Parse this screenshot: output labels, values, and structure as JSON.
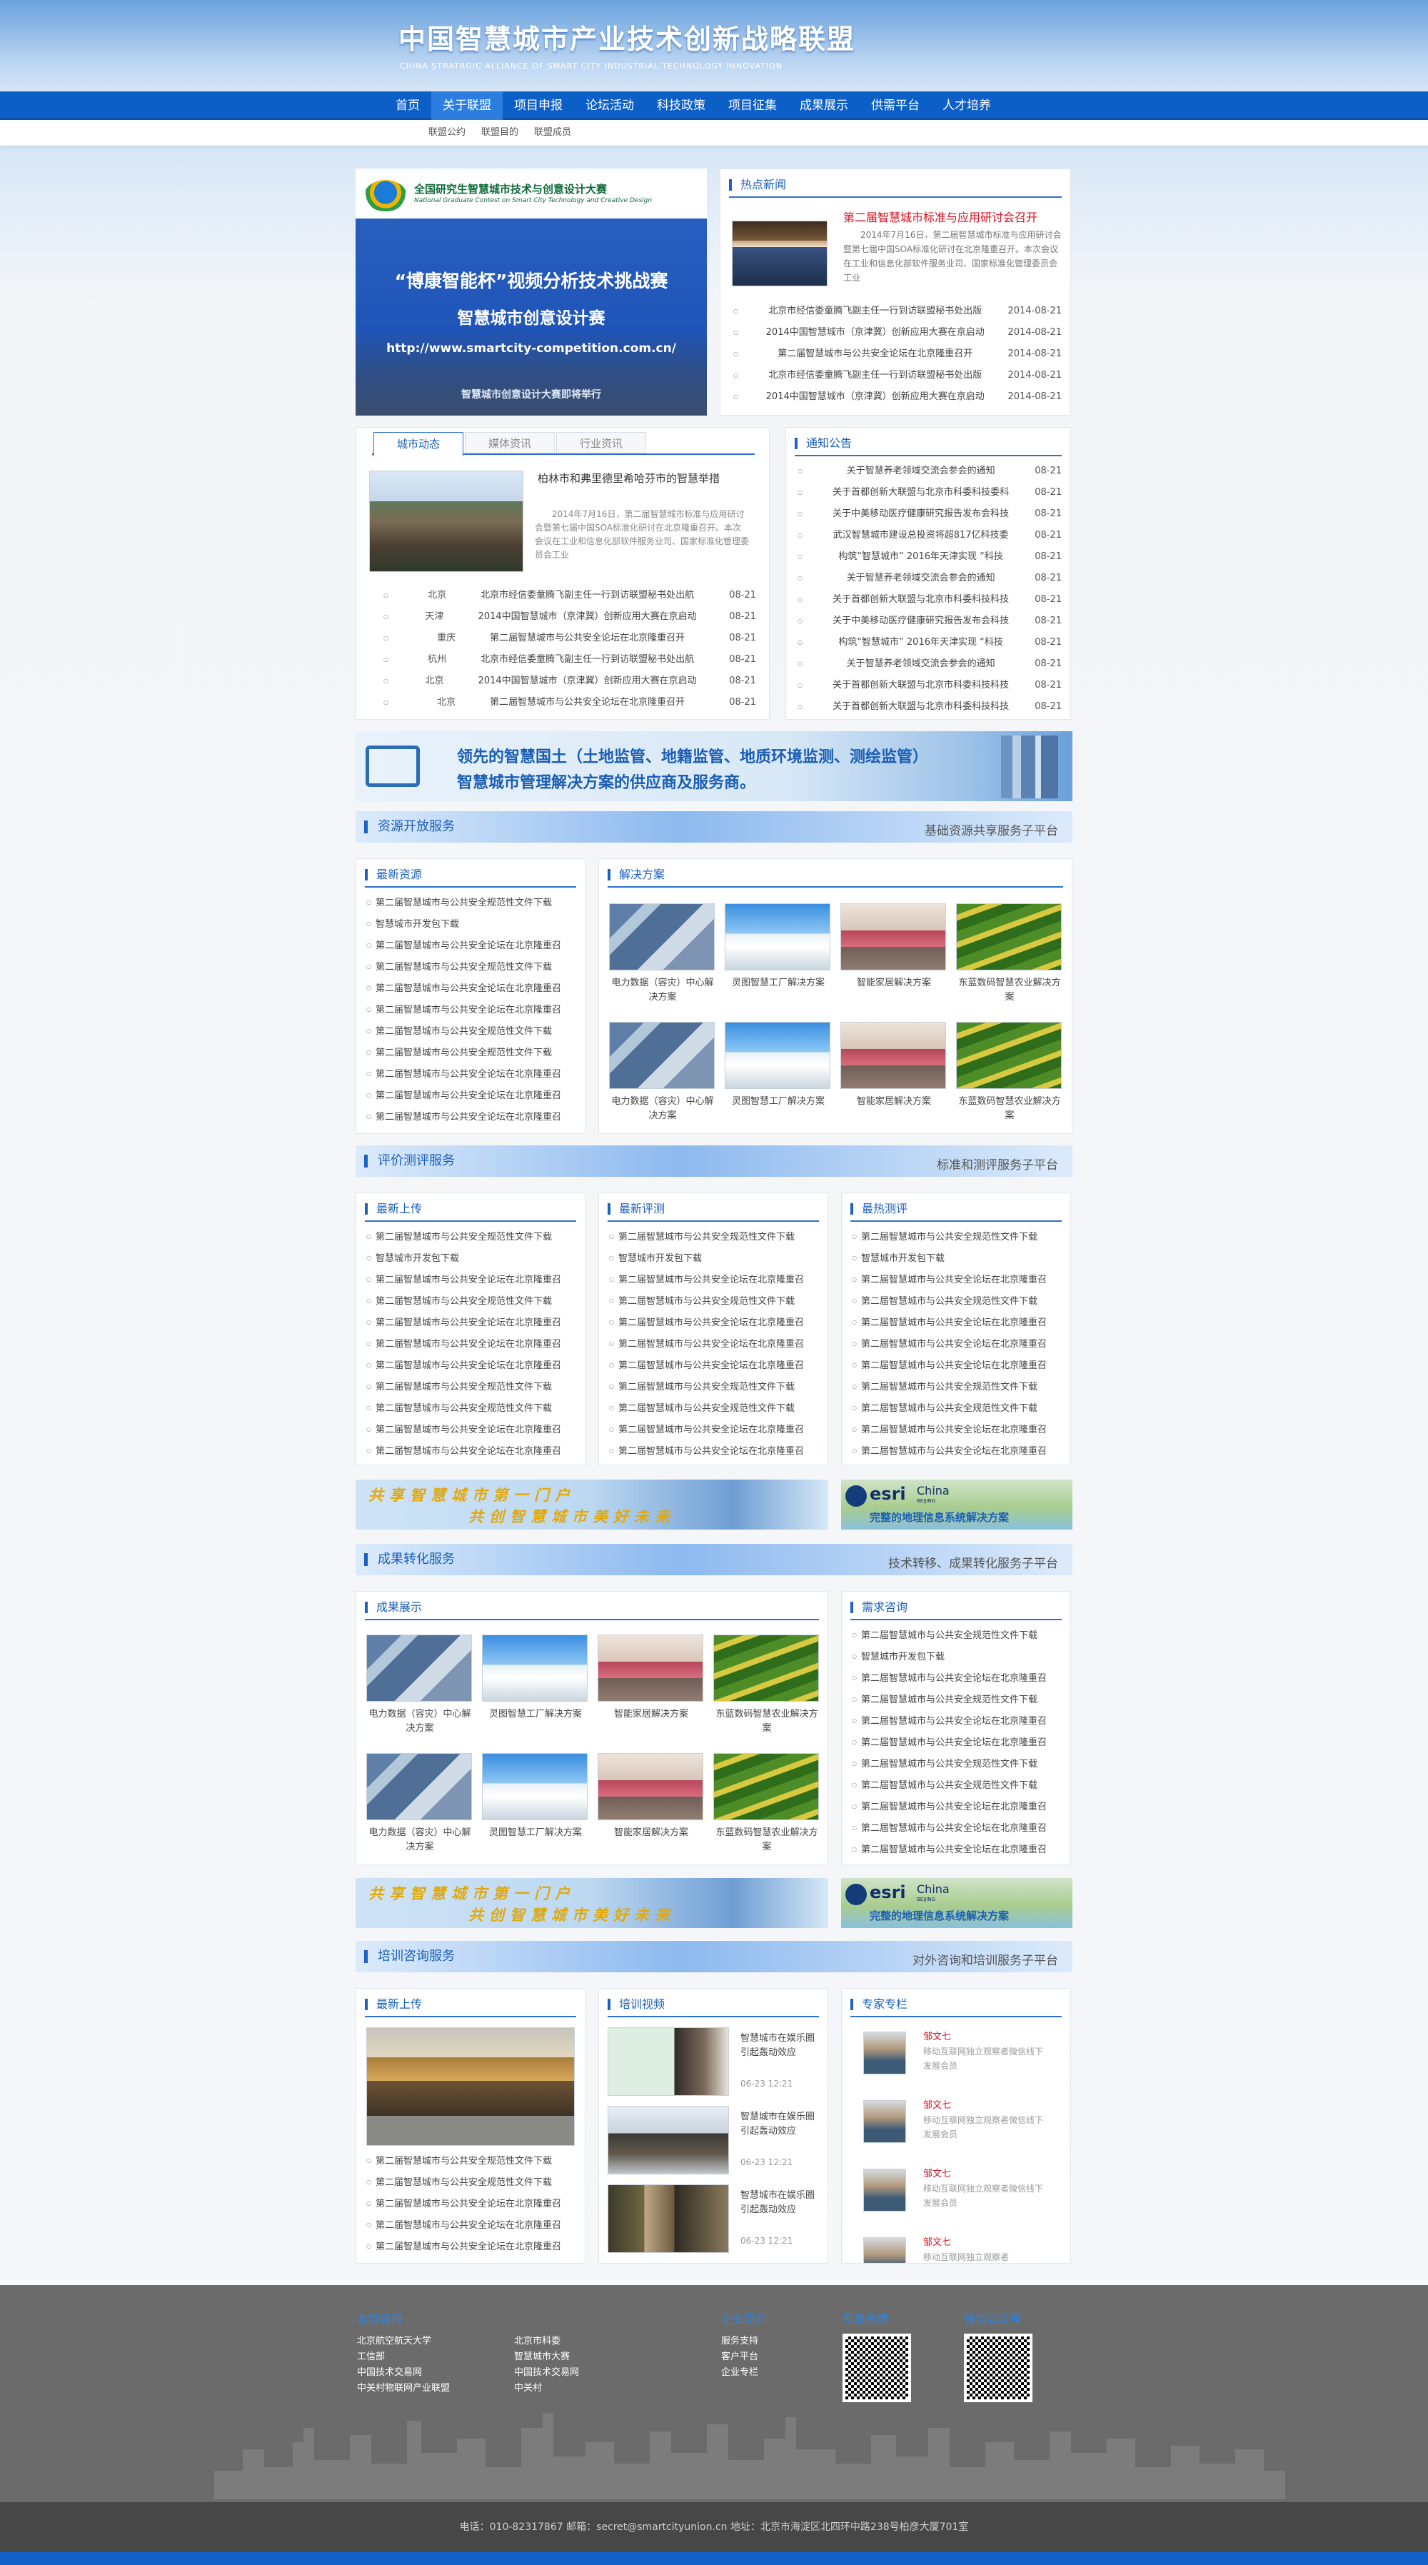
{
  "header": {
    "title": "中国智慧城市产业技术创新战略联盟",
    "subtitle": "CHINA STRATRGIC ALLIANCE OF SMART CITY INDUSTRIAL TECHNOLOGY INNOVATION"
  },
  "nav": {
    "items": [
      "首页",
      "关于联盟",
      "项目申报",
      "论坛活动",
      "科技政策",
      "项目征集",
      "成果展示",
      "供需平台",
      "人才培养"
    ],
    "active": "关于联盟"
  },
  "subnav": {
    "items": [
      "联盟公约",
      "联盟目的",
      "联盟成员"
    ]
  },
  "banner": {
    "org": "全国研究生智慧城市技术与创意设计大赛",
    "org_en": "National Graduate Contest on Smart City Technology and Creative Design",
    "l1": "“博康智能杯”视频分析技术挑战赛",
    "l2": "智慧城市创意设计赛",
    "l3": "http://www.smartcity-competition.com.cn/",
    "l4": "智慧城市创意设计大赛即将举行"
  },
  "hot": {
    "title": "热点新闻",
    "headline": "第二届智慧城市标准与应用研讨会召开",
    "summary": "2014年7月16日，第二届智慧城市标准与应用研讨会暨第七届中国SOA标准化研讨在北京隆重召开。本次会议在工业和信息化部软件服务业司、国家标准化管理委员会工业",
    "items": [
      {
        "t": "北京市经信委童腾飞副主任一行到访联盟秘书处出版",
        "d": "2014-08-21"
      },
      {
        "t": "2014中国智慧城市（京津冀）创新应用大赛在京启动",
        "d": "2014-08-21"
      },
      {
        "t": "第二届智慧城市与公共安全论坛在北京隆重召开",
        "d": "2014-08-21"
      },
      {
        "t": "北京市经信委童腾飞副主任一行到访联盟秘书处出版",
        "d": "2014-08-21"
      },
      {
        "t": "2014中国智慧城市（京津冀）创新应用大赛在京启动",
        "d": "2014-08-21"
      }
    ]
  },
  "city": {
    "tabs": [
      "城市动态",
      "媒体资讯",
      "行业资讯"
    ],
    "headline": "柏林市和弗里德里希哈芬市的智慧举措",
    "summary": "2014年7月16日，第二届智慧城市标准与应用研讨会暨第七届中国SOA标准化研讨在北京隆重召开。本次会议在工业和信息化部软件服务业司、国家标准化管理委员会工业",
    "items": [
      {
        "c": "北京",
        "t": "北京市经信委童腾飞副主任一行到访联盟秘书处出航",
        "d": "08-21"
      },
      {
        "c": "天津",
        "t": "2014中国智慧城市（京津冀）创新应用大赛在京启动",
        "d": "08-21"
      },
      {
        "c": "重庆",
        "t": "第二届智慧城市与公共安全论坛在北京隆重召开",
        "d": "08-21"
      },
      {
        "c": "杭州",
        "t": "北京市经信委童腾飞副主任一行到访联盟秘书处出航",
        "d": "08-21"
      },
      {
        "c": "北京",
        "t": "2014中国智慧城市（京津冀）创新应用大赛在京启动",
        "d": "08-21"
      },
      {
        "c": "北京",
        "t": "第二届智慧城市与公共安全论坛在北京隆重召开",
        "d": "08-21"
      }
    ]
  },
  "notice": {
    "title": "通知公告",
    "items": [
      {
        "t": "关于智慧养老领域交流会参会的通知",
        "d": "08-21"
      },
      {
        "t": "关于首都创新大联盟与北京市科委科技委科",
        "d": "08-21"
      },
      {
        "t": "关于中美移动医疗健康研究报告发布会科技",
        "d": "08-21"
      },
      {
        "t": "武汉智慧城市建设总投资将超817亿科技委",
        "d": "08-21"
      },
      {
        "t": "构筑“智慧城市” 2016年天津实现 “科技",
        "d": "08-21"
      },
      {
        "t": "关于智慧养老领域交流会参会的通知",
        "d": "08-21"
      },
      {
        "t": "关于首都创新大联盟与北京市科委科技科技",
        "d": "08-21"
      },
      {
        "t": "关于中美移动医疗健康研究报告发布会科技",
        "d": "08-21"
      },
      {
        "t": "构筑“智慧城市” 2016年天津实现 “科技",
        "d": "08-21"
      },
      {
        "t": "关于智慧养老领域交流会参会的通知",
        "d": "08-21"
      },
      {
        "t": "关于首都创新大联盟与北京市科委科技科技",
        "d": "08-21"
      },
      {
        "t": "关于首都创新大联盟与北京市科委科技科技",
        "d": "08-21"
      }
    ]
  },
  "ad1": {
    "l1": "领先的智慧国土（土地监管、地籍监管、地质环境监测、测绘监管）",
    "l2": "智慧城市管理解决方案的供应商及服务商。"
  },
  "sec1": {
    "title": "资源开放服务",
    "right": "基础资源共享服务子平台"
  },
  "sec2": {
    "title": "评价测评服务",
    "right": "标准和测评服务子平台"
  },
  "sec3": {
    "title": "成果转化服务",
    "right": "技术转移、成果转化服务子平台"
  },
  "sec4": {
    "title": "培训咨询服务",
    "right": "对外咨询和培训服务子平台"
  },
  "latest_res": {
    "title": "最新资源",
    "items": [
      "第二届智慧城市与公共安全规范性文件下载",
      "智慧城市开发包下载",
      "第二届智慧城市与公共安全论坛在北京隆重召",
      "第二届智慧城市与公共安全规范性文件下载",
      "第二届智慧城市与公共安全论坛在北京隆重召",
      "第二届智慧城市与公共安全论坛在北京隆重召",
      "第二届智慧城市与公共安全规范性文件下载",
      "第二届智慧城市与公共安全规范性文件下载",
      "第二届智慧城市与公共安全论坛在北京隆重召",
      "第二届智慧城市与公共安全论坛在北京隆重召",
      "第二届智慧城市与公共安全论坛在北京隆重召"
    ]
  },
  "solutions": {
    "title": "解决方案",
    "items": [
      "电力数据（容灾）中心解决方案",
      "灵图智慧工厂解决方案",
      "智能家居解决方案",
      "东蓝数码智慧农业解决方案",
      "电力数据（容灾）中心解决方案",
      "灵图智慧工厂解决方案",
      "智能家居解决方案",
      "东蓝数码智慧农业解决方案"
    ]
  },
  "eval": {
    "cols": [
      {
        "title": "最新上传",
        "items": [
          "第二届智慧城市与公共安全规范性文件下载",
          "智慧城市开发包下载",
          "第二届智慧城市与公共安全论坛在北京隆重召",
          "第二届智慧城市与公共安全规范性文件下载",
          "第二届智慧城市与公共安全论坛在北京隆重召",
          "第二届智慧城市与公共安全论坛在北京隆重召",
          "第二届智慧城市与公共安全论坛在北京隆重召",
          "第二届智慧城市与公共安全规范性文件下载",
          "第二届智慧城市与公共安全规范性文件下载",
          "第二届智慧城市与公共安全论坛在北京隆重召",
          "第二届智慧城市与公共安全论坛在北京隆重召"
        ]
      },
      {
        "title": "最新评测",
        "items": [
          "第二届智慧城市与公共安全规范性文件下载",
          "智慧城市开发包下载",
          "第二届智慧城市与公共安全论坛在北京隆重召",
          "第二届智慧城市与公共安全规范性文件下载",
          "第二届智慧城市与公共安全论坛在北京隆重召",
          "第二届智慧城市与公共安全论坛在北京隆重召",
          "第二届智慧城市与公共安全论坛在北京隆重召",
          "第二届智慧城市与公共安全规范性文件下载",
          "第二届智慧城市与公共安全规范性文件下载",
          "第二届智慧城市与公共安全论坛在北京隆重召",
          "第二届智慧城市与公共安全论坛在北京隆重召"
        ]
      },
      {
        "title": "最热测评",
        "items": [
          "第二届智慧城市与公共安全规范性文件下载",
          "智慧城市开发包下载",
          "第二届智慧城市与公共安全论坛在北京隆重召",
          "第二届智慧城市与公共安全规范性文件下载",
          "第二届智慧城市与公共安全论坛在北京隆重召",
          "第二届智慧城市与公共安全论坛在北京隆重召",
          "第二届智慧城市与公共安全论坛在北京隆重召",
          "第二届智慧城市与公共安全规范性文件下载",
          "第二届智慧城市与公共安全规范性文件下载",
          "第二届智慧城市与公共安全论坛在北京隆重召",
          "第二届智慧城市与公共安全论坛在北京隆重召"
        ]
      }
    ]
  },
  "ad2": {
    "l1": "共享智慧城市第一门户",
    "l2": "共创智慧城市美好未来",
    "esri": "esri",
    "china": "China",
    "beijing": "BEIJING",
    "slogan": "完整的地理信息系统解决方案"
  },
  "results": {
    "title": "成果展示",
    "items": [
      "电力数据（容灾）中心解决方案",
      "灵图智慧工厂解决方案",
      "智能家居解决方案",
      "东蓝数码智慧农业解决方案",
      "电力数据（容灾）中心解决方案",
      "灵图智慧工厂解决方案",
      "智能家居解决方案",
      "东蓝数码智慧农业解决方案"
    ]
  },
  "demand": {
    "title": "需求咨询",
    "items": [
      "第二届智慧城市与公共安全规范性文件下载",
      "智慧城市开发包下载",
      "第二届智慧城市与公共安全论坛在北京隆重召",
      "第二届智慧城市与公共安全规范性文件下载",
      "第二届智慧城市与公共安全论坛在北京隆重召",
      "第二届智慧城市与公共安全论坛在北京隆重召",
      "第二届智慧城市与公共安全规范性文件下载",
      "第二届智慧城市与公共安全规范性文件下载",
      "第二届智慧城市与公共安全论坛在北京隆重召",
      "第二届智慧城市与公共安全论坛在北京隆重召",
      "第二届智慧城市与公共安全论坛在北京隆重召"
    ]
  },
  "train_up": {
    "title": "最新上传",
    "items": [
      "第二届智慧城市与公共安全规范性文件下载",
      "第二届智慧城市与公共安全规范性文件下载",
      "第二届智慧城市与公共安全论坛在北京隆重召",
      "第二届智慧城市与公共安全论坛在北京隆重召",
      "第二届智慧城市与公共安全论坛在北京隆重召"
    ]
  },
  "videos": {
    "title": "培训视频",
    "items": [
      {
        "t": "智慧城市在娱乐圈引起轰动效应",
        "d": "06-23 12:21"
      },
      {
        "t": "智慧城市在娱乐圈引起轰动效应",
        "d": "06-23 12:21"
      },
      {
        "t": "智慧城市在娱乐圈引起轰动效应",
        "d": "06-23 12:21"
      }
    ]
  },
  "experts": {
    "title": "专家专栏",
    "items": [
      {
        "n": "邹文七",
        "d": "移动互联网独立观察者微信线下发展会员"
      },
      {
        "n": "邹文七",
        "d": "移动互联网独立观察者微信线下发展会员"
      },
      {
        "n": "邹文七",
        "d": "移动互联网独立观察者微信线下发展会员"
      },
      {
        "n": "邹文七",
        "d": "移动互联网独立观察者"
      }
    ]
  },
  "footer": {
    "links_title": "友情链接",
    "links": [
      "北京航空航天大学",
      "北京市科委",
      "工信部",
      "智慧城市大赛",
      "中国技术交易网",
      "中国技术交易网",
      "中关村物联网产业联盟",
      "中关村"
    ],
    "company_title": "企业简介",
    "company": [
      "服务支持",
      "客户平台",
      "企业专栏"
    ],
    "weibo": "新浪微博",
    "wechat": "微信公众号",
    "copyright": "电话：010-82317867 邮箱：secret@smartcityunion.cn 地址：北京市海淀区北四环中路238号柏彦大厦701室"
  }
}
